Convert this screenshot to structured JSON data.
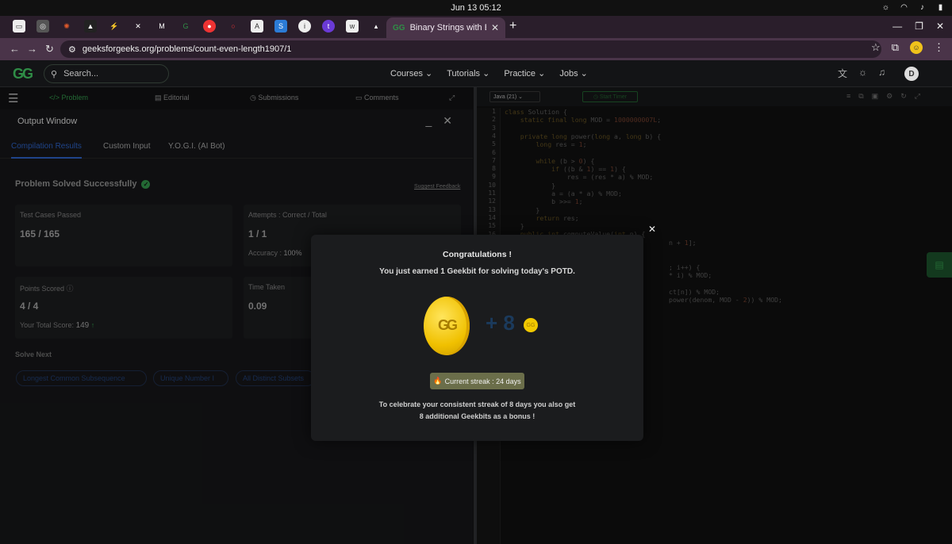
{
  "os": {
    "datetime": "Jun 13  05:12"
  },
  "browser": {
    "active_tab_title": "Binary Strings with Equal",
    "url": "geeksforgeeks.org/problems/count-even-length1907/1"
  },
  "gfg_header": {
    "search_placeholder": "Search...",
    "menu": [
      "Courses",
      "Tutorials",
      "Practice",
      "Jobs"
    ],
    "avatar_initial": "D"
  },
  "problem_tabs": {
    "problem": "</> Problem",
    "editorial": "Editorial",
    "submissions": "Submissions",
    "comments": "Comments"
  },
  "output_window": {
    "title": "Output Window",
    "tabs": [
      "Compilation Results",
      "Custom Input",
      "Y.O.G.I. (AI Bot)"
    ],
    "status": "Problem Solved Successfully",
    "suggest_feedback": "Suggest Feedback",
    "test_cases_label": "Test Cases Passed",
    "test_cases_value": "165 / 165",
    "attempts_label": "Attempts : Correct / Total",
    "attempts_value": "1 / 1",
    "accuracy_label": "Accuracy :",
    "accuracy_value": "100%",
    "points_label": "Points Scored",
    "points_value": "4 / 4",
    "total_score_label": "Your Total Score:",
    "total_score_value": "149",
    "time_label": "Time Taken",
    "time_value": "0.09",
    "solve_next_label": "Solve Next",
    "solve_next": [
      "Longest Common Subsequence",
      "Unique Number I",
      "All Distinct Subsets"
    ]
  },
  "editor": {
    "language": "Java (21)",
    "timer": "Start Timer",
    "line_numbers": [
      "1",
      "2",
      "3",
      "4",
      "5",
      "6",
      "7",
      "8",
      "9",
      "10",
      "11",
      "12",
      "13",
      "14",
      "15",
      "16"
    ]
  },
  "modal": {
    "title": "Congratulations !",
    "subtitle": "You just earned 1 Geekbit for solving today's POTD.",
    "bonus": "+ 8",
    "streak": "Current streak : 24 days",
    "celebrate_line1": "To celebrate your consistent streak of 8 days you also get",
    "celebrate_line2": "8 additional Geekbits as a bonus !"
  }
}
